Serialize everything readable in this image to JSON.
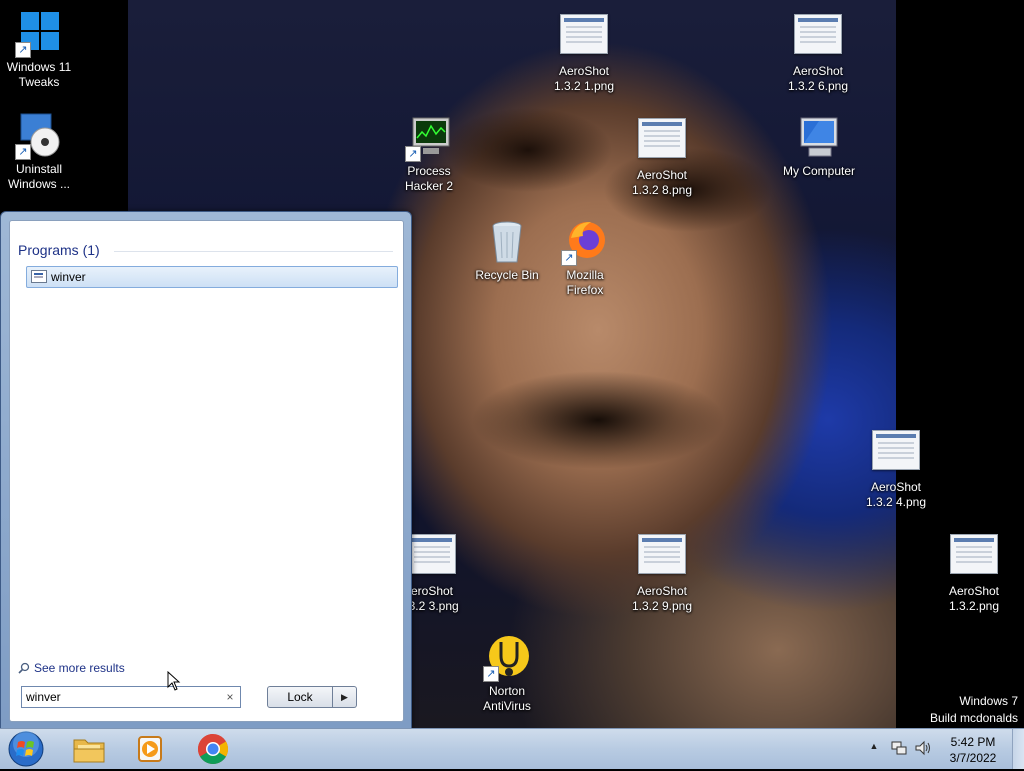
{
  "desktop": {
    "icons": [
      {
        "id": "win11tweaks",
        "line1": "Windows 11",
        "line2": "Tweaks"
      },
      {
        "id": "uninstall",
        "line1": "Uninstall",
        "line2": "Windows ..."
      },
      {
        "id": "aeroshot1",
        "line1": "AeroShot",
        "line2": "1.3.2 1.png"
      },
      {
        "id": "aeroshot6",
        "line1": "AeroShot",
        "line2": "1.3.2 6.png"
      },
      {
        "id": "processhacker",
        "line1": "Process",
        "line2": "Hacker 2"
      },
      {
        "id": "aeroshot8",
        "line1": "AeroShot",
        "line2": "1.3.2 8.png"
      },
      {
        "id": "mycomputer",
        "line1": "My Computer",
        "line2": ""
      },
      {
        "id": "recyclebin",
        "line1": "Recycle Bin",
        "line2": ""
      },
      {
        "id": "firefox",
        "line1": "Mozilla",
        "line2": "Firefox"
      },
      {
        "id": "aeroshot4",
        "line1": "AeroShot",
        "line2": "1.3.2 4.png"
      },
      {
        "id": "aeroshot3",
        "line1": "eroShot",
        "line2": ".3.2 3.png"
      },
      {
        "id": "aeroshot9",
        "line1": "AeroShot",
        "line2": "1.3.2 9.png"
      },
      {
        "id": "aeroshot",
        "line1": "AeroShot",
        "line2": "1.3.2.png"
      },
      {
        "id": "norton",
        "line1": "Norton",
        "line2": "AntiVirus"
      }
    ]
  },
  "start_menu": {
    "programs_header": "Programs (1)",
    "results": [
      "winver"
    ],
    "see_more": "See more results",
    "search_value": "winver",
    "search_clear": "×",
    "lock_label": "Lock",
    "lock_arrow": "▶"
  },
  "watermark": {
    "line1": "Windows 7",
    "line2": "Build mcdonalds"
  },
  "taskbar": {
    "pinned": [
      "explorer",
      "media-player",
      "chrome"
    ],
    "tray_arrow": "▲",
    "clock_time": "5:42 PM",
    "clock_date": "3/7/2022"
  }
}
